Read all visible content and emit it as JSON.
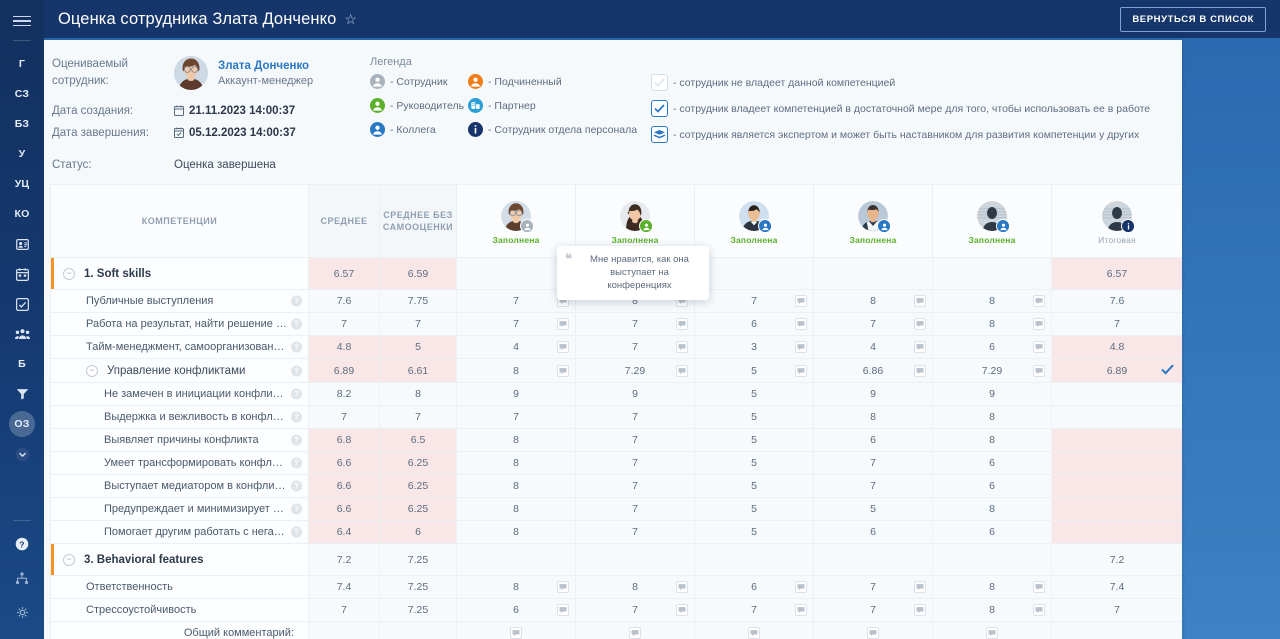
{
  "sidebar": {
    "menu_icon": "hamburger-icon",
    "items": [
      {
        "label": "Г",
        "name": "sidebar-item-g",
        "type": "text"
      },
      {
        "label": "СЗ",
        "name": "sidebar-item-sz",
        "type": "text"
      },
      {
        "label": "БЗ",
        "name": "sidebar-item-bz",
        "type": "text"
      },
      {
        "label": "У",
        "name": "sidebar-item-u",
        "type": "text"
      },
      {
        "label": "УЦ",
        "name": "sidebar-item-uc",
        "type": "text"
      },
      {
        "label": "КО",
        "name": "sidebar-item-ko",
        "type": "text"
      },
      {
        "label": "",
        "name": "sidebar-item-id-card",
        "type": "icon",
        "icon": "id-card-icon"
      },
      {
        "label": "",
        "name": "sidebar-item-calendar",
        "type": "icon",
        "icon": "calendar-icon"
      },
      {
        "label": "",
        "name": "sidebar-item-checklist",
        "type": "icon",
        "icon": "checklist-icon"
      },
      {
        "label": "",
        "name": "sidebar-item-people",
        "type": "icon",
        "icon": "people-group-icon"
      },
      {
        "label": "Б",
        "name": "sidebar-item-b",
        "type": "text"
      },
      {
        "label": "",
        "name": "sidebar-item-funnel",
        "type": "icon",
        "icon": "funnel-icon"
      },
      {
        "label": "ОЗ",
        "name": "sidebar-item-oz",
        "type": "text",
        "active": true
      },
      {
        "label": "",
        "name": "sidebar-item-chevron",
        "type": "icon",
        "icon": "chevron-down-circle-icon"
      }
    ],
    "bottom_items": [
      {
        "name": "sidebar-item-help",
        "icon": "help-circle-icon"
      },
      {
        "name": "sidebar-item-sitemap",
        "icon": "sitemap-icon"
      },
      {
        "name": "sidebar-item-settings",
        "icon": "gear-icon"
      }
    ]
  },
  "header": {
    "title": "Оценка сотрудника Злата Донченко",
    "star_icon": "star-outline-icon",
    "back_button": "ВЕРНУТЬСЯ В СПИСОК"
  },
  "info": {
    "employee_label": "Оцениваемый сотрудник:",
    "employee_name": "Злата Донченко",
    "employee_position": "Аккаунт-менеджер",
    "created_label": "Дата создания:",
    "created_value": "21.11.2023 14:00:37",
    "finished_label": "Дата завершения:",
    "finished_value": "05.12.2023 14:00:37",
    "status_label": "Статус:",
    "status_value": "Оценка завершена"
  },
  "legend": {
    "title": "Легенда",
    "col1": [
      {
        "label": "- Сотрудник",
        "color": "#a9b3bd"
      },
      {
        "label": "- Руководитель",
        "color": "#5bb02c"
      },
      {
        "label": "- Коллега",
        "color": "#2a77c4"
      }
    ],
    "col2": [
      {
        "label": "- Подчиненный",
        "color": "#f07d1a"
      },
      {
        "label": "- Партнер",
        "color": "#2a9ed6"
      },
      {
        "label": "- Сотрудник отдела персонала",
        "color": "#17356b"
      }
    ],
    "col3": [
      {
        "label": "- сотрудник не владеет данной компетенцией",
        "state": "off"
      },
      {
        "label": "- сотрудник владеет компетенцией в достаточной мере для того, чтобы использовать ее в работе",
        "state": "on"
      },
      {
        "label": "- сотрудник является экспертом и может быть наставником для развития компетенции у других",
        "state": "expert"
      }
    ]
  },
  "table": {
    "columns": [
      {
        "key": "name",
        "label": "КОМПЕТЕНЦИИ",
        "type": "name"
      },
      {
        "key": "avg",
        "label": "СРЕДНЕЕ",
        "type": "avg"
      },
      {
        "key": "avg_noself",
        "label": "СРЕДНЕЕ БЕЗ\nСАМООЦЕНКИ",
        "type": "avg"
      },
      {
        "key": "r1",
        "status": "Заполнена",
        "role": "Сотрудник",
        "badge_color": "#a9b3bd",
        "type": "rater"
      },
      {
        "key": "r2",
        "status": "Заполнена",
        "role": "Руководитель",
        "badge_color": "#5bb02c",
        "type": "rater"
      },
      {
        "key": "r3",
        "status": "Заполнена",
        "role": "Коллега",
        "badge_color": "#2a77c4",
        "type": "rater"
      },
      {
        "key": "r4",
        "status": "Заполнена",
        "role": "Коллега",
        "badge_color": "#2a77c4",
        "type": "rater"
      },
      {
        "key": "r5",
        "status": "Заполнена",
        "role": "Коллега",
        "badge_color": "#2a77c4",
        "type": "rater"
      },
      {
        "key": "final",
        "status": "Итоговая",
        "role": "Сотрудник отдела персонала",
        "badge_color": "#17356b",
        "type": "final"
      }
    ],
    "avg_header_line1": "СРЕДНЕЕ БЕЗ",
    "avg_header_line2": "САМООЦЕНКИ",
    "footer_label": "Общий комментарий:",
    "rows": [
      {
        "name": "1. Soft skills",
        "level": "group",
        "collapsible": true,
        "pink": true,
        "avg": "6.57",
        "avg_noself": "6.59",
        "r1": "",
        "r2": "",
        "r3": "",
        "r4": "",
        "r5": "",
        "final": "6.57",
        "comments": {
          "r1": false,
          "r2": false,
          "r3": false,
          "r4": false,
          "r5": false
        }
      },
      {
        "name": "Публичные выступления",
        "level": "item",
        "help": true,
        "pink": false,
        "avg": "7.6",
        "avg_noself": "7.75",
        "r1": "7",
        "r2": "8",
        "r3": "7",
        "r4": "8",
        "r5": "8",
        "final": "7.6",
        "comments": {
          "r1": true,
          "r2": true,
          "r3": true,
          "r4": true,
          "r5": true
        }
      },
      {
        "name": "Работа на результат, найти решение в сложной...",
        "level": "item",
        "help": true,
        "pink": false,
        "avg": "7",
        "avg_noself": "7",
        "r1": "7",
        "r2": "7",
        "r3": "6",
        "r4": "7",
        "r5": "8",
        "final": "7",
        "comments": {
          "r1": true,
          "r2": true,
          "r3": true,
          "r4": true,
          "r5": true
        }
      },
      {
        "name": "Тайм-менеджмент, самоорганизованность, при...",
        "level": "item",
        "help": true,
        "pink": true,
        "avg": "4.8",
        "avg_noself": "5",
        "r1": "4",
        "r2": "7",
        "r3": "3",
        "r4": "4",
        "r5": "6",
        "final": "4.8",
        "comments": {
          "r1": true,
          "r2": true,
          "r3": true,
          "r4": true,
          "r5": true
        }
      },
      {
        "name": "Управление конфликтами",
        "level": "subgroup",
        "collapsible": true,
        "help": true,
        "pink": true,
        "avg": "6.89",
        "avg_noself": "6.61",
        "r1": "8",
        "r2": "7.29",
        "r3": "5",
        "r4": "6.86",
        "r5": "7.29",
        "final": "6.89",
        "final_check": true,
        "comments": {
          "r1": true,
          "r2": true,
          "r3": true,
          "r4": true,
          "r5": true
        }
      },
      {
        "name": "Не замечен в инициации конфликтов",
        "level": "leaf",
        "help": true,
        "pink": false,
        "avg": "8.2",
        "avg_noself": "8",
        "r1": "9",
        "r2": "9",
        "r3": "5",
        "r4": "9",
        "r5": "9",
        "final": "",
        "comments": {
          "r1": false,
          "r2": false,
          "r3": false,
          "r4": false,
          "r5": false
        }
      },
      {
        "name": "Выдержка и вежливость в конфликтах",
        "level": "leaf",
        "help": true,
        "pink": false,
        "avg": "7",
        "avg_noself": "7",
        "r1": "7",
        "r2": "7",
        "r3": "5",
        "r4": "8",
        "r5": "8",
        "final": "",
        "comments": {
          "r1": false,
          "r2": false,
          "r3": false,
          "r4": false,
          "r5": false
        }
      },
      {
        "name": "Выявляет причины конфликта",
        "level": "leaf",
        "help": true,
        "pink": true,
        "avg": "6.8",
        "avg_noself": "6.5",
        "r1": "8",
        "r2": "7",
        "r3": "5",
        "r4": "6",
        "r5": "8",
        "final": "",
        "comments": {
          "r1": false,
          "r2": false,
          "r3": false,
          "r4": false,
          "r5": false
        }
      },
      {
        "name": "Умеет трансформировать конфликт в сотру...",
        "level": "leaf",
        "help": true,
        "pink": true,
        "avg": "6.6",
        "avg_noself": "6.25",
        "r1": "8",
        "r2": "7",
        "r3": "5",
        "r4": "7",
        "r5": "6",
        "final": "",
        "comments": {
          "r1": false,
          "r2": false,
          "r3": false,
          "r4": false,
          "r5": false
        }
      },
      {
        "name": "Выступает медиатором в конфликтах",
        "level": "leaf",
        "help": true,
        "pink": true,
        "avg": "6.6",
        "avg_noself": "6.25",
        "r1": "8",
        "r2": "7",
        "r3": "5",
        "r4": "7",
        "r5": "6",
        "final": "",
        "comments": {
          "r1": false,
          "r2": false,
          "r3": false,
          "r4": false,
          "r5": false
        }
      },
      {
        "name": "Предупреждает и минимизирует конфликты",
        "level": "leaf",
        "help": true,
        "pink": true,
        "avg": "6.6",
        "avg_noself": "6.25",
        "r1": "8",
        "r2": "7",
        "r3": "5",
        "r4": "5",
        "r5": "8",
        "final": "",
        "comments": {
          "r1": false,
          "r2": false,
          "r3": false,
          "r4": false,
          "r5": false
        }
      },
      {
        "name": "Помогает другим работать с негативными э...",
        "level": "leaf",
        "help": true,
        "pink": true,
        "avg": "6.4",
        "avg_noself": "6",
        "r1": "8",
        "r2": "7",
        "r3": "5",
        "r4": "6",
        "r5": "6",
        "final": "",
        "comments": {
          "r1": false,
          "r2": false,
          "r3": false,
          "r4": false,
          "r5": false
        }
      },
      {
        "name": "3. Behavioral features",
        "level": "group",
        "collapsible": true,
        "pink": false,
        "avg": "7.2",
        "avg_noself": "7.25",
        "r1": "",
        "r2": "",
        "r3": "",
        "r4": "",
        "r5": "",
        "final": "7.2",
        "comments": {
          "r1": false,
          "r2": false,
          "r3": false,
          "r4": false,
          "r5": false
        }
      },
      {
        "name": "Ответственность",
        "level": "item",
        "pink": false,
        "avg": "7.4",
        "avg_noself": "7.25",
        "r1": "8",
        "r2": "8",
        "r3": "6",
        "r4": "7",
        "r5": "8",
        "final": "7.4",
        "comments": {
          "r1": true,
          "r2": true,
          "r3": true,
          "r4": true,
          "r5": true
        }
      },
      {
        "name": "Стрессоустойчивость",
        "level": "item",
        "pink": false,
        "avg": "7",
        "avg_noself": "7.25",
        "r1": "6",
        "r2": "7",
        "r3": "7",
        "r4": "7",
        "r5": "8",
        "final": "7",
        "comments": {
          "r1": true,
          "r2": true,
          "r3": true,
          "r4": true,
          "r5": true
        }
      }
    ]
  },
  "tooltip": {
    "quote_icon": "quote-icon",
    "text": "Мне нравится, как она выступает на конференциях"
  },
  "colors": {
    "accent": "#2a77c4",
    "topbar": "#16366b",
    "pink": "#f9e7e8",
    "orange": "#f59425",
    "green": "#5bb02c"
  }
}
